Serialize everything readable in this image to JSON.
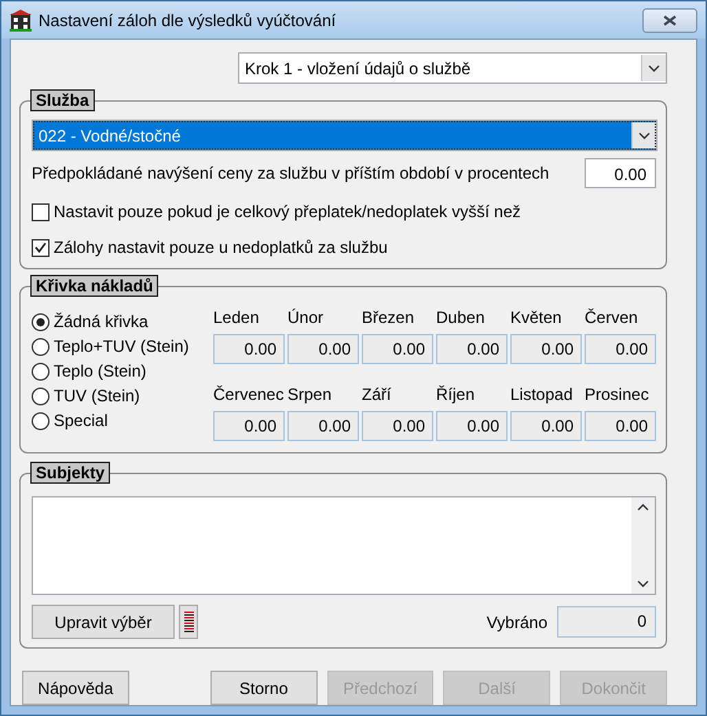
{
  "window": {
    "title": "Nastavení záloh dle výsledků vyúčtování"
  },
  "step_select": {
    "value": "Krok 1 - vložení údajů o službě"
  },
  "service": {
    "legend": "Služba",
    "select": {
      "value": "022 - Vodné/stočné",
      "focused": true
    },
    "increase_label": "Předpokládané navýšení ceny za službu v příštím období  v procentech",
    "increase_value": "0.00",
    "checkboxes": [
      {
        "label": "Nastavit pouze pokud je celkový přeplatek/nedoplatek vyšší než",
        "checked": false
      },
      {
        "label": "Zálohy nastavit pouze u nedoplatků za službu",
        "checked": true
      }
    ]
  },
  "cost_curve": {
    "legend": "Křivka nákladů",
    "options": [
      {
        "label": "Žádná křivka",
        "selected": true
      },
      {
        "label": "Teplo+TUV  (Stein)",
        "selected": false
      },
      {
        "label": "Teplo  (Stein)",
        "selected": false
      },
      {
        "label": "TUV  (Stein)",
        "selected": false
      },
      {
        "label": "Special",
        "selected": false
      }
    ],
    "months": [
      {
        "label": "Leden",
        "value": "0.00"
      },
      {
        "label": "Únor",
        "value": "0.00"
      },
      {
        "label": "Březen",
        "value": "0.00"
      },
      {
        "label": "Duben",
        "value": "0.00"
      },
      {
        "label": "Květen",
        "value": "0.00"
      },
      {
        "label": "Červen",
        "value": "0.00"
      },
      {
        "label": "Červenec",
        "value": "0.00"
      },
      {
        "label": "Srpen",
        "value": "0.00"
      },
      {
        "label": "Září",
        "value": "0.00"
      },
      {
        "label": "Říjen",
        "value": "0.00"
      },
      {
        "label": "Listopad",
        "value": "0.00"
      },
      {
        "label": "Prosinec",
        "value": "0.00"
      }
    ]
  },
  "subjects": {
    "legend": "Subjekty",
    "edit_button": "Upravit výběr",
    "selected_label": "Vybráno",
    "selected_count": "0"
  },
  "buttons": [
    {
      "label": "Nápověda",
      "disabled": false
    },
    {
      "label": "Storno",
      "disabled": false
    },
    {
      "label": "Předchozí",
      "disabled": true
    },
    {
      "label": "Další",
      "disabled": true
    },
    {
      "label": "Dokončit",
      "disabled": true
    }
  ]
}
